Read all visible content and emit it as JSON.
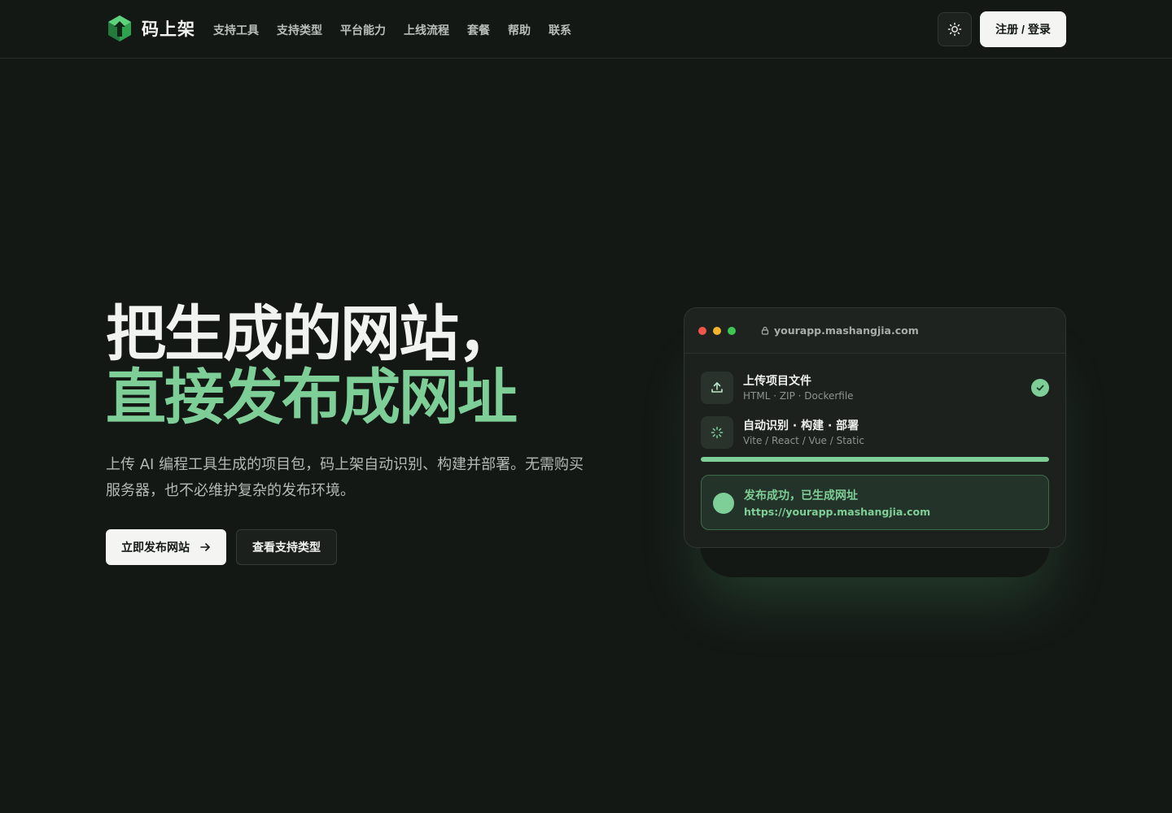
{
  "nav": {
    "brand": "码上架",
    "links": [
      "支持工具",
      "支持类型",
      "平台能力",
      "上线流程",
      "套餐",
      "帮助",
      "联系"
    ],
    "theme_icon": "sun-icon",
    "login_label": "注册 / 登录"
  },
  "hero": {
    "title_line1": "把生成的网站，",
    "title_line2": "直接发布成网址",
    "description": "上传 AI 编程工具生成的项目包，码上架自动识别、构建并部署。无需购买服务器，也不必维护复杂的发布环境。",
    "primary_cta": "立即发布网站",
    "primary_cta_icon": "arrow-right-icon",
    "secondary_cta": "查看支持类型"
  },
  "preview": {
    "url": "yourapp.mashangjia.com",
    "steps": [
      {
        "title": "上传项目文件",
        "subtitle": "HTML · ZIP · Dockerfile",
        "icon": "upload-icon",
        "status": "done"
      },
      {
        "title": "自动识别 · 构建 · 部署",
        "subtitle": "Vite / React / Vue / Static",
        "icon": "loading-spinner-icon",
        "status": "in-progress"
      }
    ],
    "progress": 1.0,
    "success_title": "发布成功，已生成网址",
    "success_url": "https://yourapp.mashangjia.com"
  },
  "colors": {
    "background": "#141815",
    "accent": "#7ecf97",
    "card": "#1c211d",
    "button_light": "#f4f5f2"
  }
}
